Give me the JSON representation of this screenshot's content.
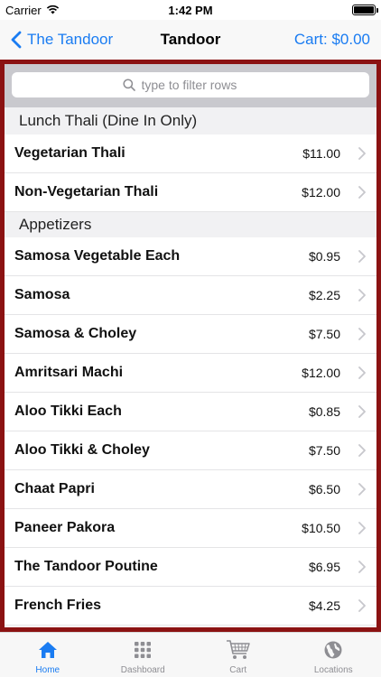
{
  "status_bar": {
    "carrier": "Carrier",
    "time": "1:42 PM",
    "battery_level": 1.0
  },
  "nav": {
    "back_label": "The Tandoor",
    "title": "Tandoor",
    "cart_label": "Cart: $0.00"
  },
  "search": {
    "placeholder": "type to filter rows",
    "value": ""
  },
  "sections": [
    {
      "header": "Lunch Thali (Dine In Only)",
      "items": [
        {
          "name": "Vegetarian Thali",
          "price": "$11.00"
        },
        {
          "name": "Non-Vegetarian Thali",
          "price": "$12.00"
        }
      ]
    },
    {
      "header": "Appetizers",
      "items": [
        {
          "name": "Samosa Vegetable Each",
          "price": "$0.95"
        },
        {
          "name": "Samosa",
          "price": "$2.25"
        },
        {
          "name": "Samosa & Choley",
          "price": "$7.50"
        },
        {
          "name": "Amritsari Machi",
          "price": "$12.00"
        },
        {
          "name": "Aloo Tikki Each",
          "price": "$0.85"
        },
        {
          "name": "Aloo Tikki & Choley",
          "price": "$7.50"
        },
        {
          "name": "Chaat Papri",
          "price": "$6.50"
        },
        {
          "name": "Paneer Pakora",
          "price": "$10.50"
        },
        {
          "name": "The Tandoor Poutine",
          "price": "$6.95"
        },
        {
          "name": "French Fries",
          "price": "$4.25"
        }
      ]
    }
  ],
  "tabs": [
    {
      "label": "Home",
      "icon": "home-icon",
      "active": true
    },
    {
      "label": "Dashboard",
      "icon": "grid-icon",
      "active": false
    },
    {
      "label": "Cart",
      "icon": "cart-icon",
      "active": false
    },
    {
      "label": "Locations",
      "icon": "globe-icon",
      "active": false
    }
  ],
  "colors": {
    "accent": "#1a7cf2",
    "frame_border": "#8b1212",
    "search_bar_bg": "#c9c9ce",
    "section_header_bg": "#f1f1f3"
  }
}
